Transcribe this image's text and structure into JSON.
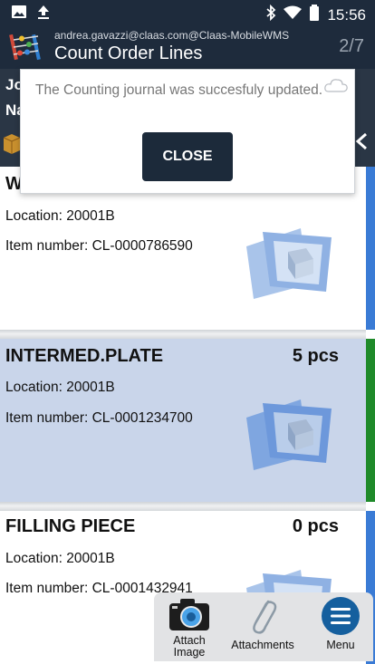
{
  "statusbar": {
    "time": "15:56"
  },
  "appbar": {
    "user": "andrea.gavazzi@claas.com@Claas-MobileWMS",
    "title": "Count Order Lines",
    "pager": "2/7"
  },
  "background_header": {
    "line1": "Jo",
    "line2": "Na",
    "line3": "W"
  },
  "dialog": {
    "message": "The Counting journal was succesfuly updated.",
    "close_label": "CLOSE"
  },
  "cards": [
    {
      "name": "W",
      "qty": "",
      "location": "Location: 20001B",
      "item": "Item number: CL-0000786590",
      "stripe": "#3a7bd5",
      "highlighted": false
    },
    {
      "name": "INTERMED.PLATE",
      "qty": "5 pcs",
      "location": "Location: 20001B",
      "item": "Item number: CL-0001234700",
      "stripe": "#1f8a2a",
      "highlighted": true
    },
    {
      "name": "FILLING PIECE",
      "qty": "0 pcs",
      "location": "Location: 20001B",
      "item": "Item number: CL-0001432941",
      "stripe": "#3a7bd5",
      "highlighted": false
    }
  ],
  "bottombar": {
    "attach_image": "Attach\nImage",
    "attachments": "Attachments",
    "menu": "Menu"
  },
  "colors": {
    "appbar": "#1e2b3c",
    "highlight": "#c9d5ea",
    "accent": "#1f6fb3",
    "ok": "#1f8a2a"
  }
}
